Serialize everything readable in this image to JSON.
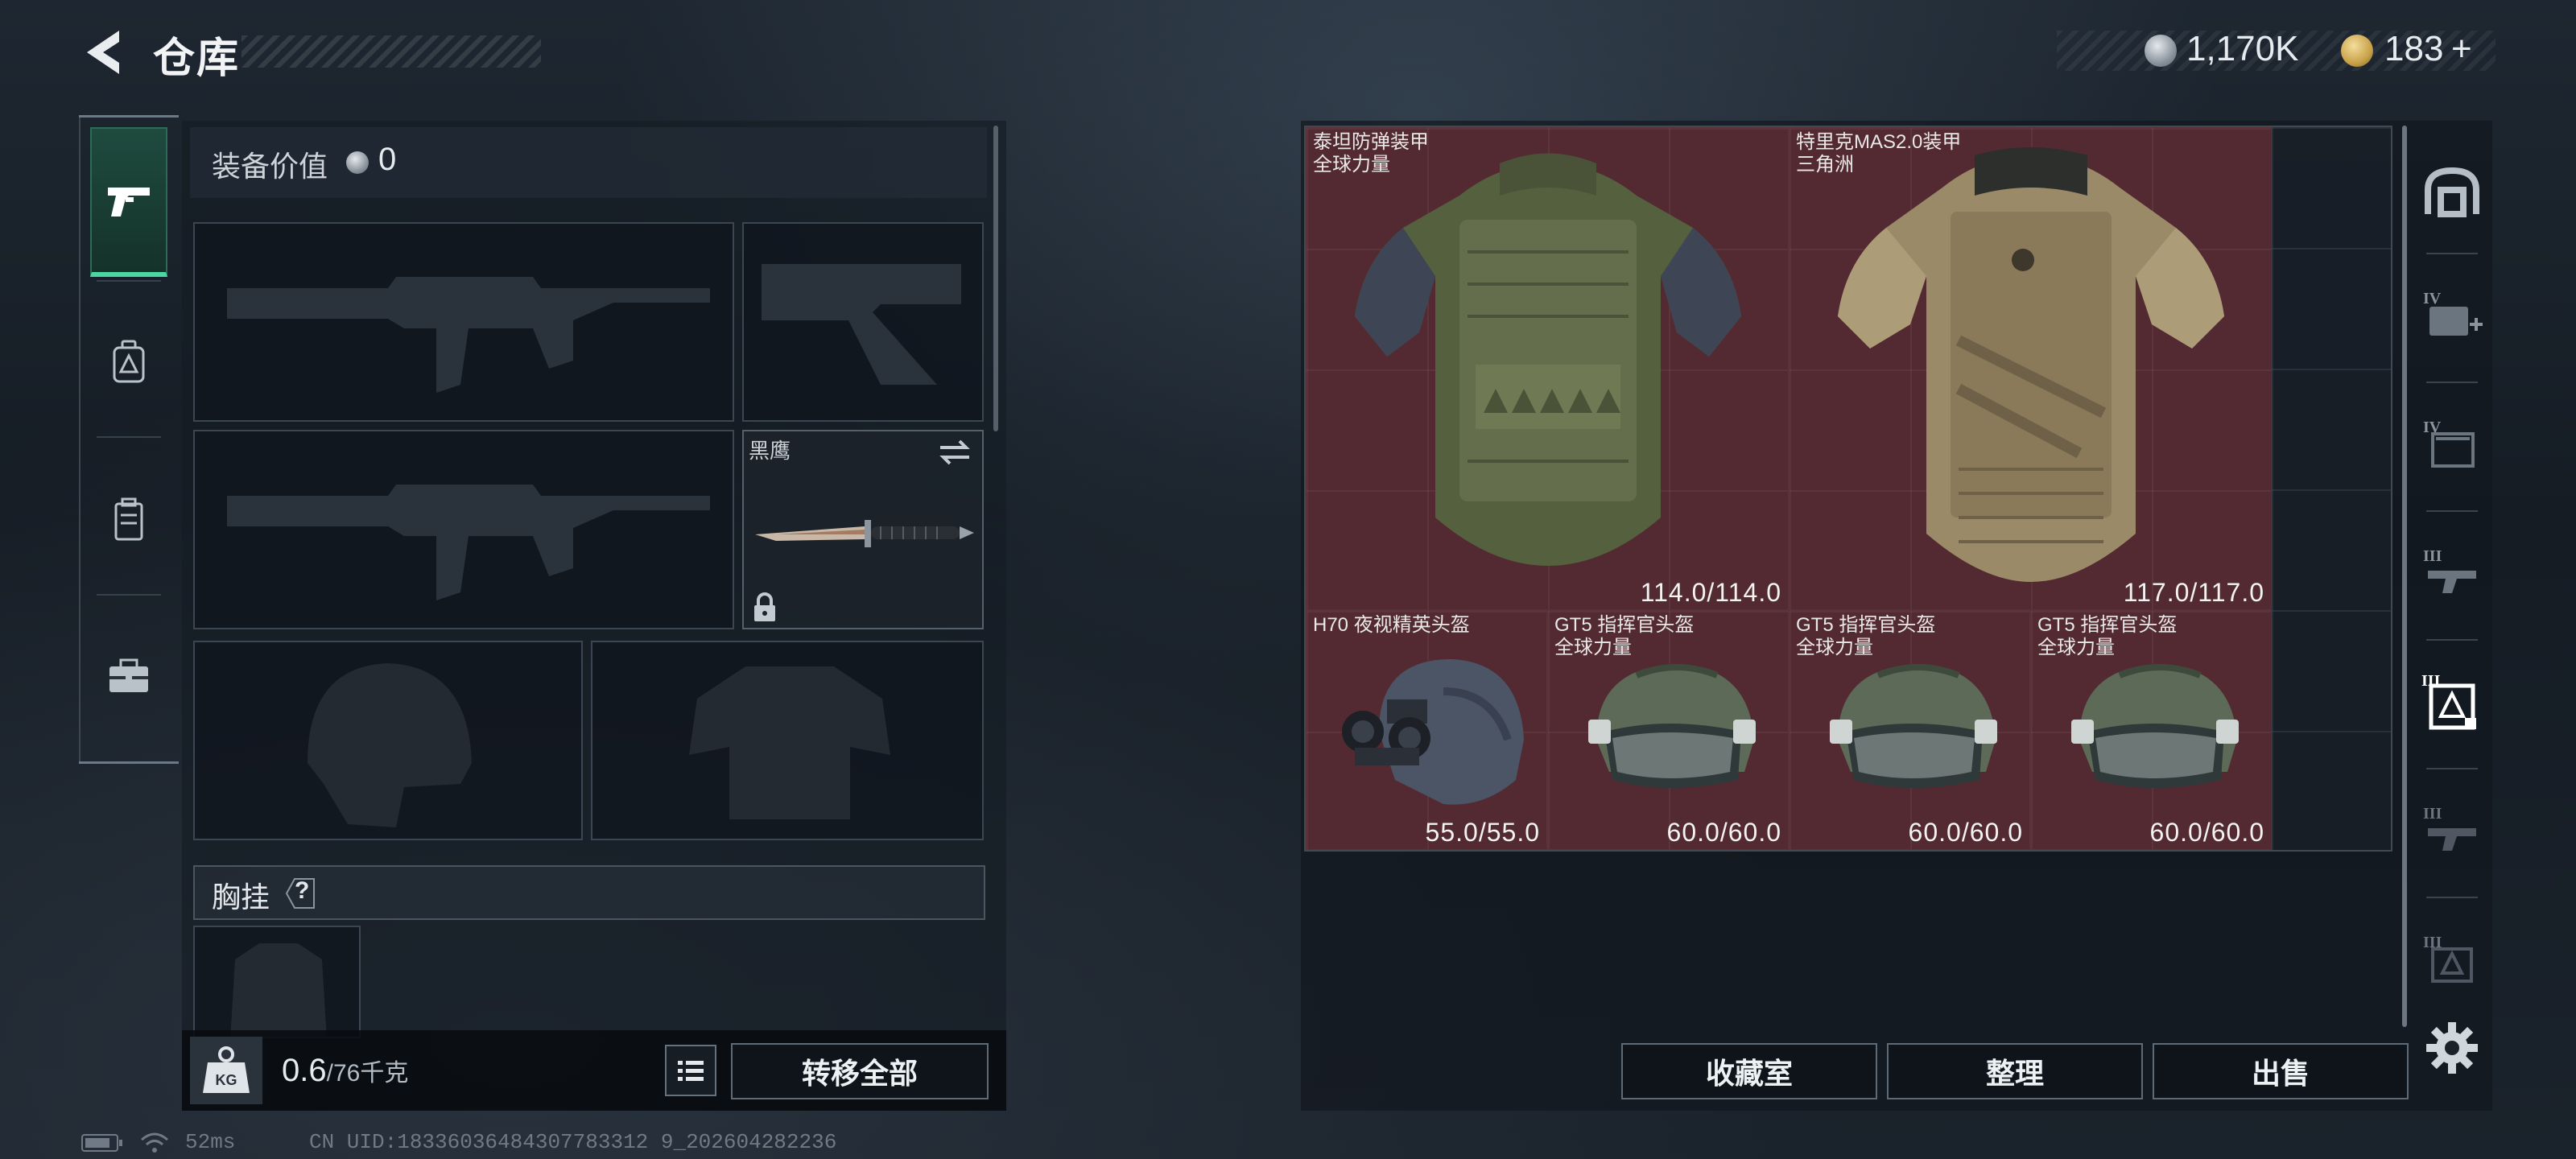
{
  "header": {
    "title": "仓库",
    "currency1": "1,170K",
    "currency2": "183",
    "currency2_plus": "+"
  },
  "nav": {
    "items": [
      "pistol-icon",
      "backpack-icon",
      "rig-icon",
      "briefcase-icon"
    ],
    "active": 0
  },
  "equipment": {
    "value_label": "装备价值",
    "value": "0",
    "knife_label": "黑鹰",
    "chest_label": "胸挂",
    "chest_help": "?",
    "weight_value": "0.6",
    "weight_max": "/76千克",
    "transfer_all": "转移全部"
  },
  "storage": {
    "items": [
      {
        "name": "泰坦防弹装甲",
        "sub": "全球力量",
        "durability": "114.0/114.0"
      },
      {
        "name": "特里克MAS2.0装甲",
        "sub": "三角洲",
        "durability": "117.0/117.0"
      },
      {
        "name": "H70 夜视精英头盔",
        "sub": "",
        "durability": "55.0/55.0"
      },
      {
        "name": "GT5 指挥官头盔",
        "sub": "全球力量",
        "durability": "60.0/60.0"
      },
      {
        "name": "GT5 指挥官头盔",
        "sub": "全球力量",
        "durability": "60.0/60.0"
      },
      {
        "name": "GT5 指挥官头盔",
        "sub": "全球力量",
        "durability": "60.0/60.0"
      }
    ],
    "buttons": {
      "collection": "收藏室",
      "organize": "整理",
      "sell": "出售"
    },
    "filters": [
      "home-icon",
      "IV",
      "IV",
      "III",
      "III",
      "III",
      "III"
    ]
  },
  "status": {
    "ping": "52ms",
    "uid": "CN UID:18336036484307783312 9_202604282236"
  },
  "colors": {
    "accent_green": "#4ad6a3",
    "item_bg": "#532a31",
    "coin_silver": "#9aa3ad",
    "coin_gold": "#c9a24a"
  }
}
